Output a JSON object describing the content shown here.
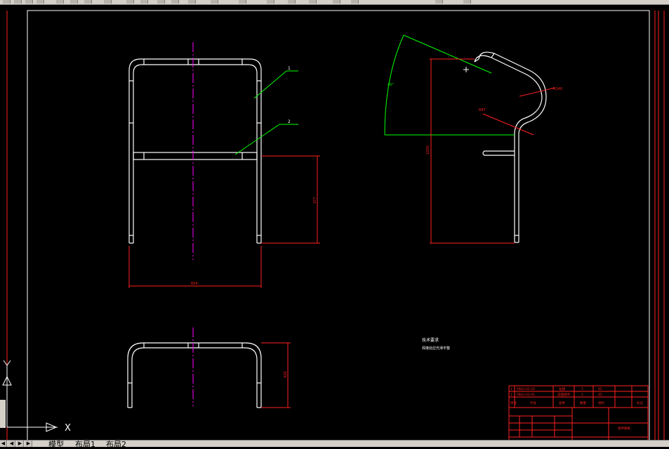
{
  "toolbar": {
    "icons": [
      "new-icon",
      "open-icon",
      "save-icon",
      "print-icon",
      "preview-icon",
      "cut-icon",
      "copy-icon",
      "paste-icon",
      "match-icon",
      "undo-icon",
      "redo-icon",
      "pan-icon",
      "zoom-icon",
      "zoom-window-icon",
      "zoom-previous-icon",
      "properties-icon",
      "designcenter-icon",
      "toolpalette-icon",
      "calculator-icon",
      "help-icon",
      "layer-icon",
      "layer-state-icon"
    ]
  },
  "tabs": {
    "model": "模型",
    "layout1": "布局1",
    "layout2": "布局2"
  },
  "ucs": {
    "y": "Y",
    "x": "X"
  },
  "drawing": {
    "callout1": "1",
    "callout2": "2",
    "front_width_dim": "654",
    "front_height_dim": "377",
    "top_depth_dim": "420",
    "side_height_dim": "1050",
    "side_radius_large": "R140",
    "side_radius_small": "R87",
    "side_angle": "45°",
    "tech_req_title": "技术要求",
    "tech_req_line": "焊接处应光滑平整"
  },
  "title_block": {
    "rows": [
      [
        "2",
        "PBLU-02-02",
        "左腿",
        "1",
        "45"
      ],
      [
        "1",
        "PBLU-02-01",
        "支腿组件",
        "1",
        "45"
      ]
    ],
    "header": [
      "序号",
      "代号",
      "名称",
      "数量",
      "材料"
    ],
    "drawing_name": "组件图纸",
    "company": "标记"
  },
  "colors": {
    "background": "#000000",
    "geometry": "#ffffff",
    "dimension": "#ff0000",
    "centerline": "#ff00ff",
    "leader": "#00ff00",
    "frame": "#ff0000"
  }
}
